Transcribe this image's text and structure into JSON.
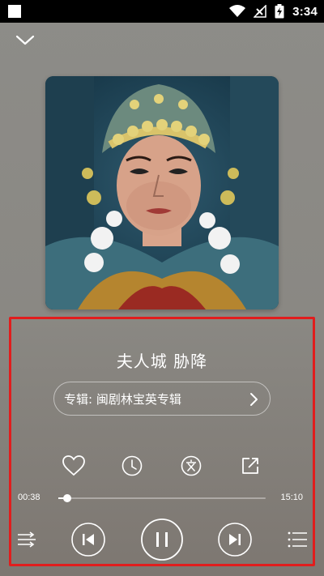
{
  "status_bar": {
    "time": "3:34"
  },
  "player": {
    "title": "夫人城 胁降",
    "album_label": "专辑: 闽剧林宝英专辑",
    "elapsed": "00:38",
    "total": "15:10",
    "progress_fraction": 0.042
  },
  "icons": {
    "collapse": "chevron-down-icon",
    "favorite": "heart-icon",
    "timer": "clock-icon",
    "lyrics": "lyrics-text-icon",
    "share": "share-icon",
    "mode": "playback-mode-icon",
    "prev": "previous-icon",
    "play_pause": "pause-icon",
    "next": "next-icon",
    "playlist": "playlist-icon"
  },
  "colors": {
    "highlight_border": "#e11d1d"
  }
}
